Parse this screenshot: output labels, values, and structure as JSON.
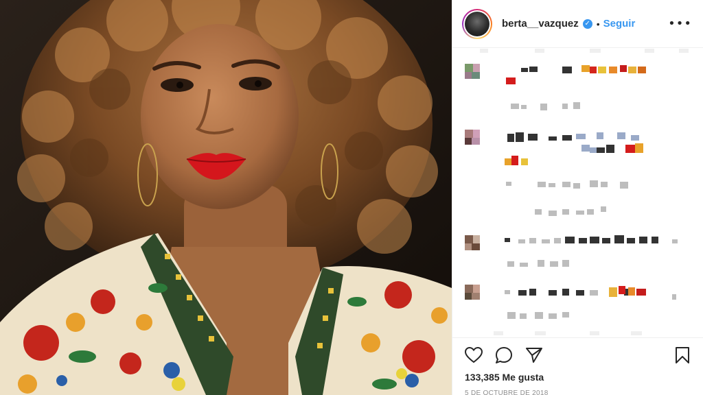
{
  "post": {
    "username": "berta__vazquez",
    "verified_badge": "verified-check-icon",
    "separator": "•",
    "follow_label": "Seguir",
    "more_icon": "•••",
    "likes_text": "133,385 Me gusta",
    "date_text": "5 DE OCTUBRE DE 2018"
  },
  "actions": {
    "icons": [
      "heart-icon",
      "comment-icon",
      "share-icon",
      "bookmark-icon"
    ]
  },
  "colors": {
    "accent": "#3897f0",
    "text": "#262626",
    "muted": "#8e8e8e",
    "divider": "#efefef"
  }
}
